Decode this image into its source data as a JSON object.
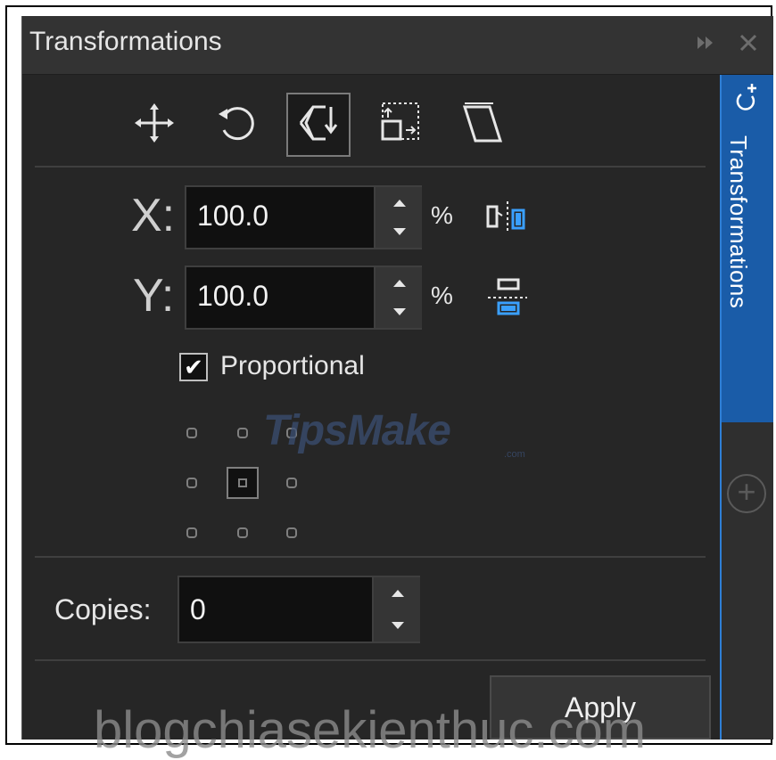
{
  "panel": {
    "title": "Transformations",
    "expand_icon": "double-chevron-right-icon",
    "close_icon": "close-icon"
  },
  "toolbar": {
    "tools": [
      {
        "name": "position",
        "icon": "move-arrows-icon",
        "active": false
      },
      {
        "name": "rotate",
        "icon": "rotate-icon",
        "active": false
      },
      {
        "name": "scale-and-mirror",
        "icon": "scale-mirror-icon",
        "active": true
      },
      {
        "name": "size",
        "icon": "size-icon",
        "active": false
      },
      {
        "name": "skew",
        "icon": "skew-icon",
        "active": false
      }
    ]
  },
  "scale": {
    "x_label": "X:",
    "x_value": "100.0",
    "x_unit": "%",
    "y_label": "Y:",
    "y_value": "100.0",
    "y_unit": "%",
    "mirror_h_icon": "mirror-horizontal-icon",
    "mirror_v_icon": "mirror-vertical-icon",
    "proportional_label": "Proportional",
    "proportional_checked": true,
    "anchor_selected": "center"
  },
  "copies": {
    "label": "Copies:",
    "value": "0"
  },
  "apply_label": "Apply",
  "side_tab": {
    "label": "Transformations",
    "icon": "rotate-plus-icon",
    "add_icon": "add-circle-icon"
  },
  "watermarks": {
    "logo_text": "TipsMake",
    "logo_suffix": ".com",
    "site_text": "blogchiasekienthuc.com"
  },
  "colors": {
    "accent": "#1a5ca8",
    "rail_border": "#2f7fd6",
    "mirror_icon_blue": "#3aa0ff",
    "panel_bg": "#262626"
  }
}
